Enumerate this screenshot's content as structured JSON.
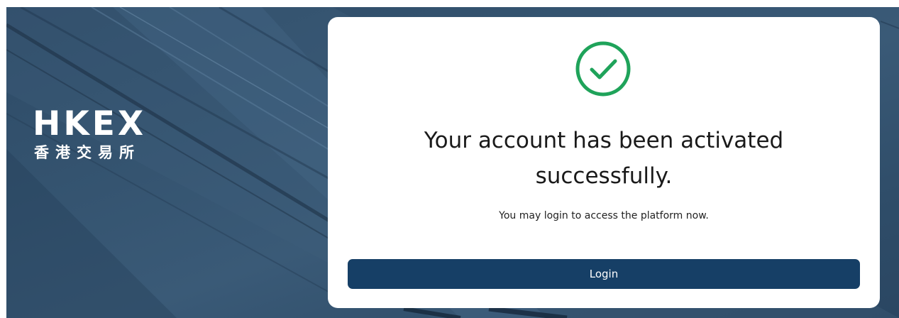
{
  "brand": {
    "logo_en": "HKEX",
    "logo_zh": "香港交易所"
  },
  "card": {
    "title_line1": "Your account has been activated",
    "title_line2": "successfully.",
    "message": "You may login to access the platform now.",
    "login_label": "Login"
  },
  "icons": {
    "status": "check-circle-icon"
  },
  "colors": {
    "background": "#34536f",
    "success_green": "#1fa35a",
    "button": "#163f66",
    "card": "#ffffff"
  }
}
